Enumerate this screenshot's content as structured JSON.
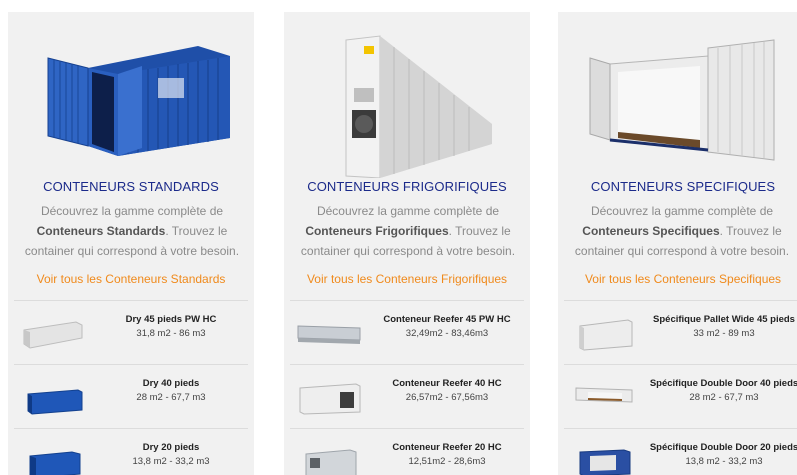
{
  "colors": {
    "card_background": "#f1f1f1",
    "title": "#1b2a8a",
    "link": "#f08a1c",
    "description": "#8a8a8a"
  },
  "cards": [
    {
      "image": "blue-container-open-doors-icon",
      "title": "CONTENEURS STANDARDS",
      "desc_prefix": "Découvrez la gamme complète de",
      "desc_bold": "Conteneurs Standards",
      "desc_suffix": ". Trouvez le container qui correspond à votre besoin.",
      "link": "Voir tous les Conteneurs Standards",
      "items": [
        {
          "icon": "white-45ft-container-icon",
          "name": "Dry 45 pieds PW HC",
          "size": "31,8 m2 - 86 m3"
        },
        {
          "icon": "blue-40ft-container-icon",
          "name": "Dry 40 pieds",
          "size": "28 m2 - 67,7 m3"
        },
        {
          "icon": "blue-20ft-container-icon",
          "name": "Dry 20 pieds",
          "size": "13,8 m2 - 33,2 m3"
        }
      ]
    },
    {
      "image": "reefer-container-icon",
      "title": "CONTENEURS FRIGORIFIQUES",
      "desc_prefix": "Découvrez la gamme complète de",
      "desc_bold": "Conteneurs Frigorifiques",
      "desc_suffix": ". Trouvez le container qui correspond à votre besoin.",
      "link": "Voir tous les Conteneurs Frigorifiques",
      "items": [
        {
          "icon": "reefer-45-container-icon",
          "name": "Conteneur Reefer 45 PW HC",
          "size": "32,49m2 - 83,46m3"
        },
        {
          "icon": "reefer-40-container-icon",
          "name": "Conteneur Reefer 40 HC",
          "size": "26,57m2 - 67,56m3"
        },
        {
          "icon": "reefer-20-container-icon",
          "name": "Conteneur Reefer 20 HC",
          "size": "12,51m2 - 28,6m3"
        }
      ]
    },
    {
      "image": "open-side-container-icon",
      "title": "CONTENEURS SPECIFIQUES",
      "desc_prefix": "Découvrez la gamme complète de",
      "desc_bold": "Conteneurs Specifiques",
      "desc_suffix": ". Trouvez le container qui correspond à votre besoin.",
      "link": "Voir tous les Conteneurs Specifiques",
      "items": [
        {
          "icon": "pallet-wide-container-icon",
          "name": "Spécifique Pallet Wide 45 pieds",
          "size": "33 m2 - 89 m3"
        },
        {
          "icon": "double-door-40-container-icon",
          "name": "Spécifique Double Door 40 pieds",
          "size": "28 m2 - 67,7 m3"
        },
        {
          "icon": "double-door-20-container-icon",
          "name": "Spécifique Double Door 20 pieds",
          "size": "13,8 m2 - 33,2 m3"
        }
      ]
    }
  ]
}
